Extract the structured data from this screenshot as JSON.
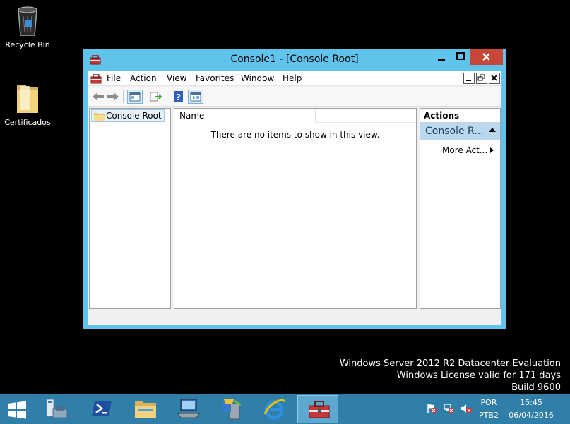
{
  "desktop": {
    "icons": [
      {
        "label": "Recycle Bin",
        "icon": "recycle-bin-icon"
      },
      {
        "label": "Certificados",
        "icon": "folder-icon"
      }
    ]
  },
  "window": {
    "title": "Console1 - [Console Root]",
    "menu": [
      "File",
      "Action",
      "View",
      "Favorites",
      "Window",
      "Help"
    ],
    "tree": {
      "root_label": "Console Root"
    },
    "list": {
      "column_name": "Name",
      "empty_message": "There are no items to show in this view."
    },
    "actions": {
      "header": "Actions",
      "group_label": "Console R...",
      "more_actions": "More Act..."
    }
  },
  "watermark": {
    "line1": "Windows Server 2012 R2 Datacenter Evaluation",
    "line2": "Windows License valid for 171 days",
    "line3": "Build 9600"
  },
  "taskbar": {
    "apps": [
      "start-icon",
      "server-manager-icon",
      "powershell-icon",
      "file-explorer-icon",
      "remote-desktop-icon",
      "sql-setup-icon",
      "internet-explorer-icon",
      "mmc-toolbox-icon"
    ],
    "tray": {
      "language": "POR",
      "layout": "PTB2",
      "time": "15:45",
      "date": "06/04/2016"
    }
  },
  "colors": {
    "window_frame": "#60c3ec",
    "close_button": "#c7473a",
    "taskbar": "#2f7fa8"
  }
}
